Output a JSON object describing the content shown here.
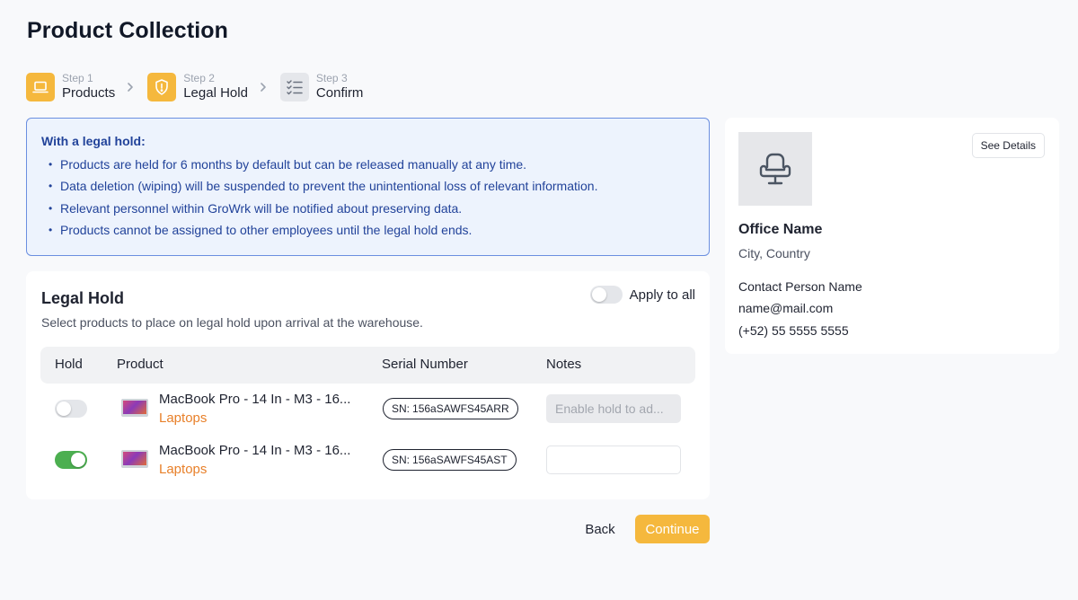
{
  "page": {
    "title": "Product Collection"
  },
  "stepper": {
    "steps": [
      {
        "small": "Step 1",
        "label": "Products",
        "icon": "laptop-icon",
        "state": "complete"
      },
      {
        "small": "Step 2",
        "label": "Legal Hold",
        "icon": "shield-alert-icon",
        "state": "active"
      },
      {
        "small": "Step 3",
        "label": "Confirm",
        "icon": "checklist-icon",
        "state": "inactive"
      }
    ],
    "separator_icon": "chevron-right-icon"
  },
  "info": {
    "heading": "With a legal hold:",
    "items": [
      "Products are held for 6 months by default but can be released manually at any time.",
      "Data deletion (wiping) will be suspended to prevent the unintentional loss of relevant information.",
      "Relevant personnel within GroWrk will be notified about preserving data.",
      "Products cannot be assigned to other employees until the legal hold ends."
    ]
  },
  "legal_hold": {
    "title": "Legal Hold",
    "subtitle": "Select products to place on legal hold upon arrival at the warehouse.",
    "apply_all_label": "Apply to all",
    "apply_all_on": false,
    "columns": [
      "Hold",
      "Product",
      "Serial Number",
      "Notes"
    ],
    "rows": [
      {
        "hold": false,
        "name": "MacBook Pro - 14 In - M3 - 16...",
        "category": "Laptops",
        "sn_prefix": "SN:",
        "serial": "156aSAWFS45ARR",
        "notes_value": "",
        "notes_placeholder": "Enable hold to ad..."
      },
      {
        "hold": true,
        "name": "MacBook Pro - 14 In - M3 - 16...",
        "category": "Laptops",
        "sn_prefix": "SN:",
        "serial": "156aSAWFS45AST",
        "notes_value": "",
        "notes_placeholder": ""
      }
    ]
  },
  "actions": {
    "back_label": "Back",
    "continue_label": "Continue"
  },
  "office": {
    "image_icon": "office-chair-icon",
    "see_details_label": "See Details",
    "name": "Office Name",
    "location": "City, Country",
    "contact_name": "Contact Person Name",
    "contact_email": "name@mail.com",
    "contact_phone": "(+52) 55 5555 5555"
  },
  "colors": {
    "accent": "#f5b83d",
    "info_bg": "#edf3fd",
    "info_border": "#6b8fe0",
    "info_text": "#22439a",
    "toggle_on": "#4caf50",
    "category": "#e8802a"
  }
}
